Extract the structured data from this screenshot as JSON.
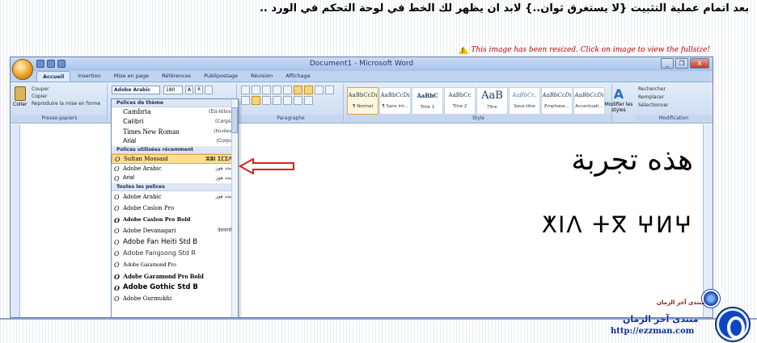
{
  "post": {
    "heading": "بعد اتمام عملية التثبيت {لا يستغرق ثوان..} لابد ان يظهر لك الخط في لوحة التحكم في الورد ..",
    "resize_notice": "This image has been resized. Click on image to view the fullsize!"
  },
  "word": {
    "window_title": "Document1 - Microsoft Word",
    "window_controls": [
      "_",
      "❐",
      "X"
    ],
    "tabs": [
      "Accueil",
      "Insertion",
      "Mise en page",
      "Références",
      "Publipostage",
      "Révision",
      "Affichage"
    ],
    "clipboard": {
      "paste": "Coller",
      "cut": "Couper",
      "copy": "Copier",
      "format_painter": "Reproduire la mise en forme",
      "group_label": "Presse-papiers"
    },
    "font": {
      "current_font": "Adobe Arabic",
      "current_size": "180",
      "grow": "A",
      "shrink": "A"
    },
    "paragraph_label": "Paragraphe",
    "styles": {
      "group_label": "Style",
      "modify_label": "Modifier les styles",
      "items": [
        {
          "sample": "AaBbCcDı",
          "name": "¶ Normal",
          "selected": true
        },
        {
          "sample": "AaBbCcDı",
          "name": "¶ Sans int...",
          "selected": false
        },
        {
          "sample": "AaBbC",
          "name": "Titre 1",
          "selected": false
        },
        {
          "sample": "AaBbCc",
          "name": "Titre 2",
          "selected": false
        },
        {
          "sample": "AaB",
          "name": "Titre",
          "selected": false
        },
        {
          "sample": "AaBbCc.",
          "name": "Sous-titre",
          "selected": false
        },
        {
          "sample": "AaBbCcDı",
          "name": "Emphase...",
          "selected": false
        },
        {
          "sample": "AaBbCcDı",
          "name": "Accentuati...",
          "selected": false
        }
      ]
    },
    "editing": {
      "find": "Rechercher",
      "replace": "Remplacer",
      "select": "Sélectionner",
      "group_label": "Modification"
    },
    "document": {
      "arabic_text": "هذه تجربة",
      "tifinagh_text": "ⵅⵏⴷ ⵜⴳ ⵖⵍⵖ"
    },
    "font_dropdown": {
      "section_theme": "Polices de thème",
      "theme_fonts": [
        {
          "name": "Cambria",
          "tag": "(En-têtes)"
        },
        {
          "name": "Calibri",
          "tag": "(Corps)"
        },
        {
          "name": "Times New Roman",
          "tag": "(En-têtes)"
        },
        {
          "name": "Arial",
          "tag": "(Corps)"
        }
      ],
      "section_recent": "Polices utilisées récemment",
      "recent_fonts": [
        {
          "name": "Sultan Mossaid",
          "preview": "ⵣⴻⵏ ⵉⵎⵉⴷ",
          "highlighted": true
        },
        {
          "name": "Adobe Arabic",
          "preview": "أبجد هوز",
          "highlighted": false
        },
        {
          "name": "Arial",
          "preview": "أبجد هوز",
          "highlighted": false
        }
      ],
      "section_all": "Toutes les polices",
      "all_fonts": [
        {
          "name": "Adobe Arabic",
          "preview": "أبجد هوز"
        },
        {
          "name": "Adobe Caslon Pro",
          "preview": ""
        },
        {
          "name": "Adobe Caslon Pro Bold",
          "preview": ""
        },
        {
          "name": "Adobe Devanagari",
          "preview": "देवनागरी"
        },
        {
          "name": "Adobe Fan Heiti Std B",
          "preview": ""
        },
        {
          "name": "Adobe Fangsong Std R",
          "preview": ""
        },
        {
          "name": "Adobe Garamond Pro",
          "preview": ""
        },
        {
          "name": "Adobe Garamond Pro Bold",
          "preview": ""
        },
        {
          "name": "Adobe Gothic Std B",
          "preview": ""
        },
        {
          "name": "Adobe Gurmukhi",
          "preview": ""
        }
      ]
    }
  },
  "watermark": {
    "small_title": "منتدى آخر الزمان",
    "title": "منتدى آخر الزمان",
    "url": "http://ezzman.com"
  },
  "colors": {
    "notice_red": "#c00000",
    "arrow_red": "#d62020",
    "watermark_blue": "#0b2f99"
  }
}
